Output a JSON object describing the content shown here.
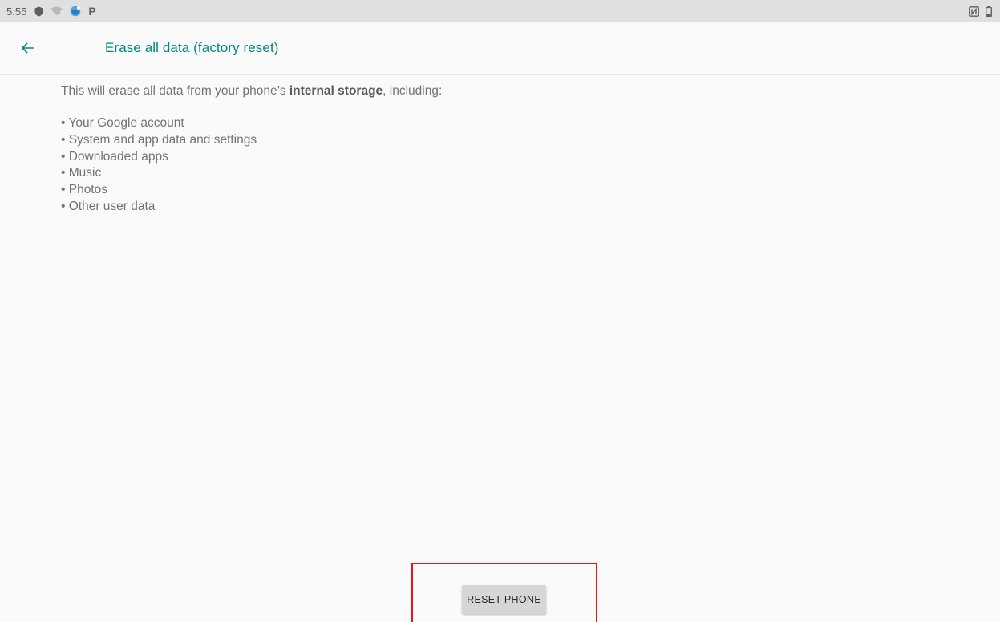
{
  "status_bar": {
    "time": "5:55",
    "left_icons": [
      "shield-icon",
      "wifi-icon",
      "vpn-globe-icon",
      "parking-p-icon"
    ],
    "right_icons": [
      "nfc-icon",
      "battery-icon"
    ],
    "p_glyph": "P",
    "background": "#e0e0e0"
  },
  "app_bar": {
    "title": "Erase all data (factory reset)",
    "back_icon": "arrow-left-icon",
    "accent": "#00897b"
  },
  "content": {
    "intro_before": "This will erase all data from your phone’s ",
    "intro_bold": "internal storage",
    "intro_after": ", including:",
    "items": [
      "• Your Google account",
      "• System and app data and settings",
      "• Downloaded apps",
      "• Music",
      "• Photos",
      "• Other user data"
    ]
  },
  "actions": {
    "reset_label": "RESET PHONE",
    "highlight_color": "#e8151b"
  }
}
